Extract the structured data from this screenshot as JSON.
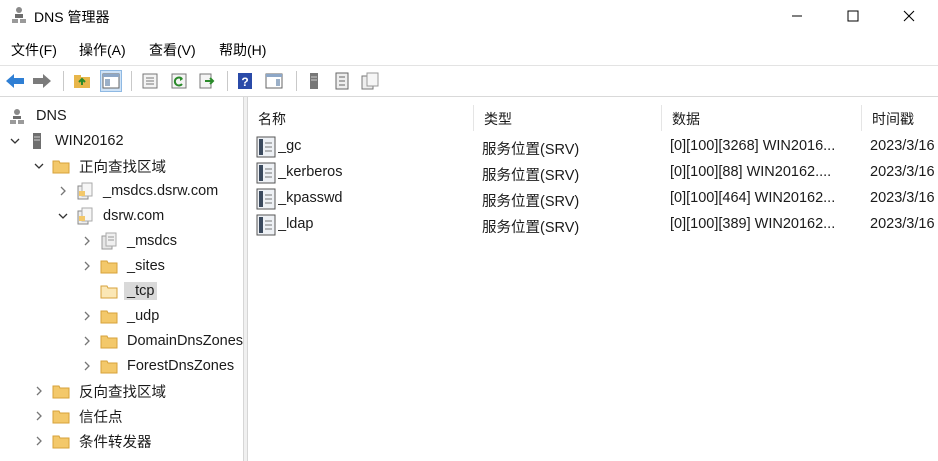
{
  "window": {
    "title": "DNS 管理器",
    "icon": "dns-manager-icon"
  },
  "menu": [
    {
      "label": "文件(F)"
    },
    {
      "label": "操作(A)"
    },
    {
      "label": "查看(V)"
    },
    {
      "label": "帮助(H)"
    }
  ],
  "toolbar": {
    "icons": [
      "back-arrow-icon",
      "forward-arrow-icon",
      "up-folder-icon",
      "show-hide-tree-icon",
      "properties-icon",
      "refresh-icon",
      "export-list-icon",
      "help-icon",
      "show-hide-action-pane-icon",
      "server-icon",
      "record-list-icon",
      "zone-icon"
    ]
  },
  "tree": {
    "items": [
      {
        "label": "DNS",
        "icon": "dns-icon",
        "expander": "none"
      },
      {
        "label": "WIN20162",
        "icon": "server-icon",
        "expander": "expanded"
      },
      {
        "label": "正向查找区域",
        "icon": "folder-icon",
        "expander": "expanded"
      },
      {
        "label": "_msdcs.dsrw.com",
        "icon": "zone-icon",
        "expander": "collapsed"
      },
      {
        "label": "dsrw.com",
        "icon": "zone-icon",
        "expander": "expanded"
      },
      {
        "label": "_msdcs",
        "icon": "delegated-zone-icon",
        "expander": "collapsed"
      },
      {
        "label": "_sites",
        "icon": "folder-icon",
        "expander": "collapsed"
      },
      {
        "label": "_tcp",
        "icon": "folder-icon",
        "expander": "none",
        "selected": true
      },
      {
        "label": "_udp",
        "icon": "folder-icon",
        "expander": "collapsed"
      },
      {
        "label": "DomainDnsZones",
        "icon": "folder-icon",
        "expander": "collapsed"
      },
      {
        "label": "ForestDnsZones",
        "icon": "folder-icon",
        "expander": "collapsed"
      },
      {
        "label": "反向查找区域",
        "icon": "folder-icon",
        "expander": "collapsed"
      },
      {
        "label": "信任点",
        "icon": "folder-icon",
        "expander": "collapsed"
      },
      {
        "label": "条件转发器",
        "icon": "folder-icon",
        "expander": "collapsed"
      }
    ]
  },
  "list": {
    "columns": [
      "名称",
      "类型",
      "数据",
      "时间戳"
    ],
    "rows": [
      {
        "name": "_gc",
        "type": "服务位置(SRV)",
        "data": "[0][100][3268] WIN2016...",
        "timestamp": "2023/3/16"
      },
      {
        "name": "_kerberos",
        "type": "服务位置(SRV)",
        "data": "[0][100][88] WIN20162....",
        "timestamp": "2023/3/16"
      },
      {
        "name": "_kpasswd",
        "type": "服务位置(SRV)",
        "data": "[0][100][464] WIN20162...",
        "timestamp": "2023/3/16"
      },
      {
        "name": "_ldap",
        "type": "服务位置(SRV)",
        "data": "[0][100][389] WIN20162...",
        "timestamp": "2023/3/16"
      }
    ]
  },
  "colors": {
    "selection": "#d9d9d9",
    "folder": "#f3c86a",
    "accent": "#1f6fc5"
  }
}
